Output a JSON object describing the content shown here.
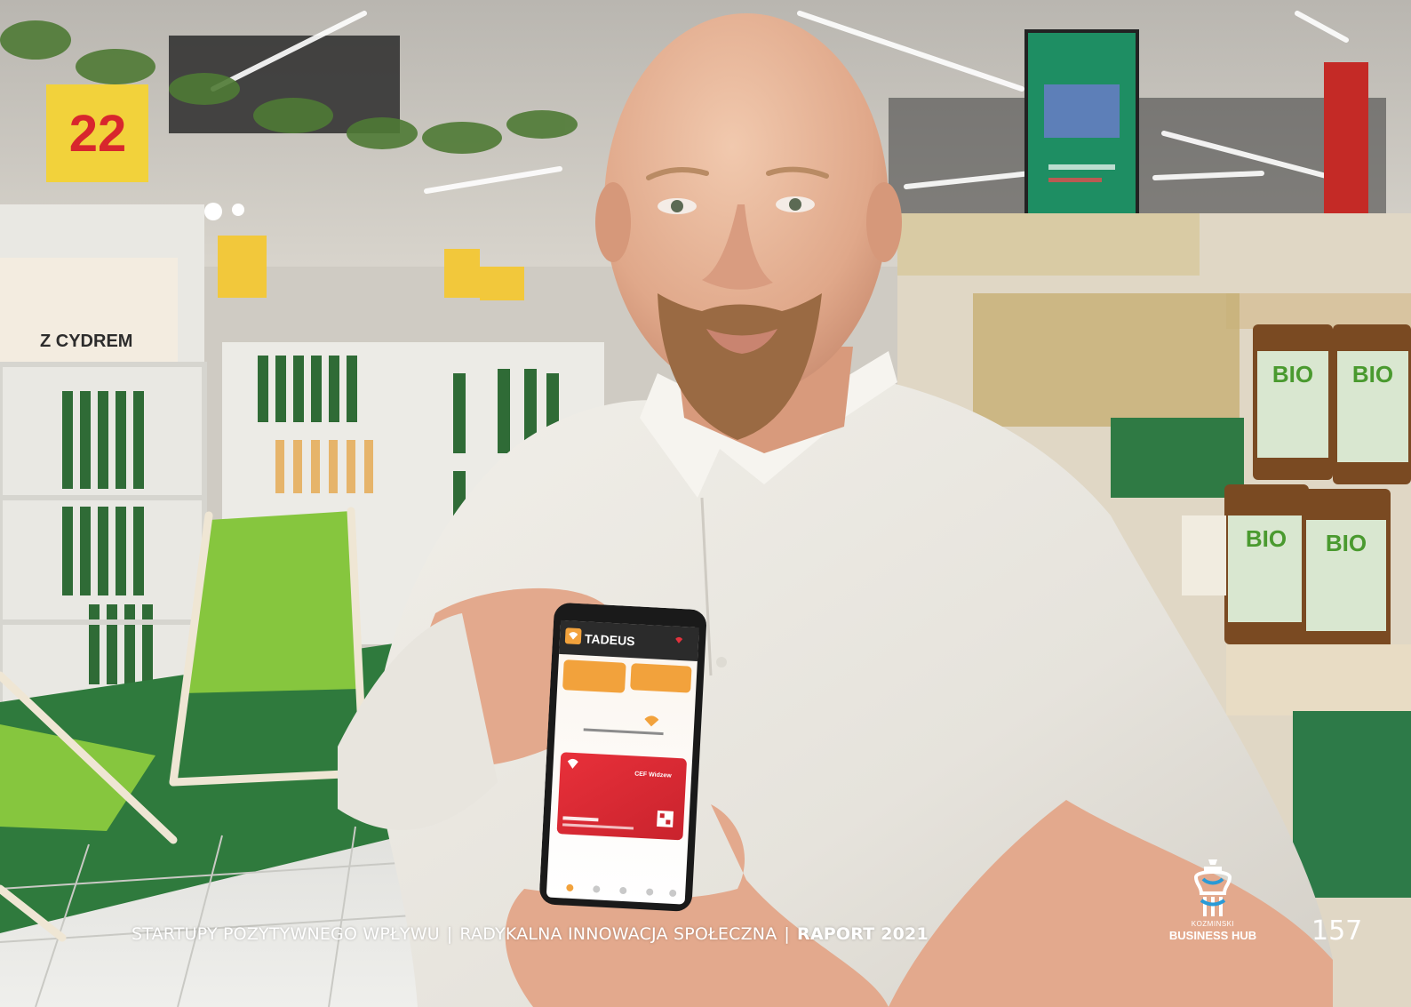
{
  "footer": {
    "title": "STARTUPY POZYTYWNEGO WPŁYWU",
    "separator1": "|",
    "subtitle": "RADYKALNA INNOWACJA SPOŁECZNA",
    "separator2": "|",
    "report": "RAPORT 2021"
  },
  "logo": {
    "line1": "KOZMINSKI",
    "line2": "BUSINESS HUB"
  },
  "page_number": "157",
  "phone": {
    "app_name": "TADEUS",
    "card_subtitle": "CEF Widzew"
  },
  "colors": {
    "accent_orange": "#f2a23c",
    "card_red": "#e2323d",
    "footer_text": "#ffffff"
  }
}
